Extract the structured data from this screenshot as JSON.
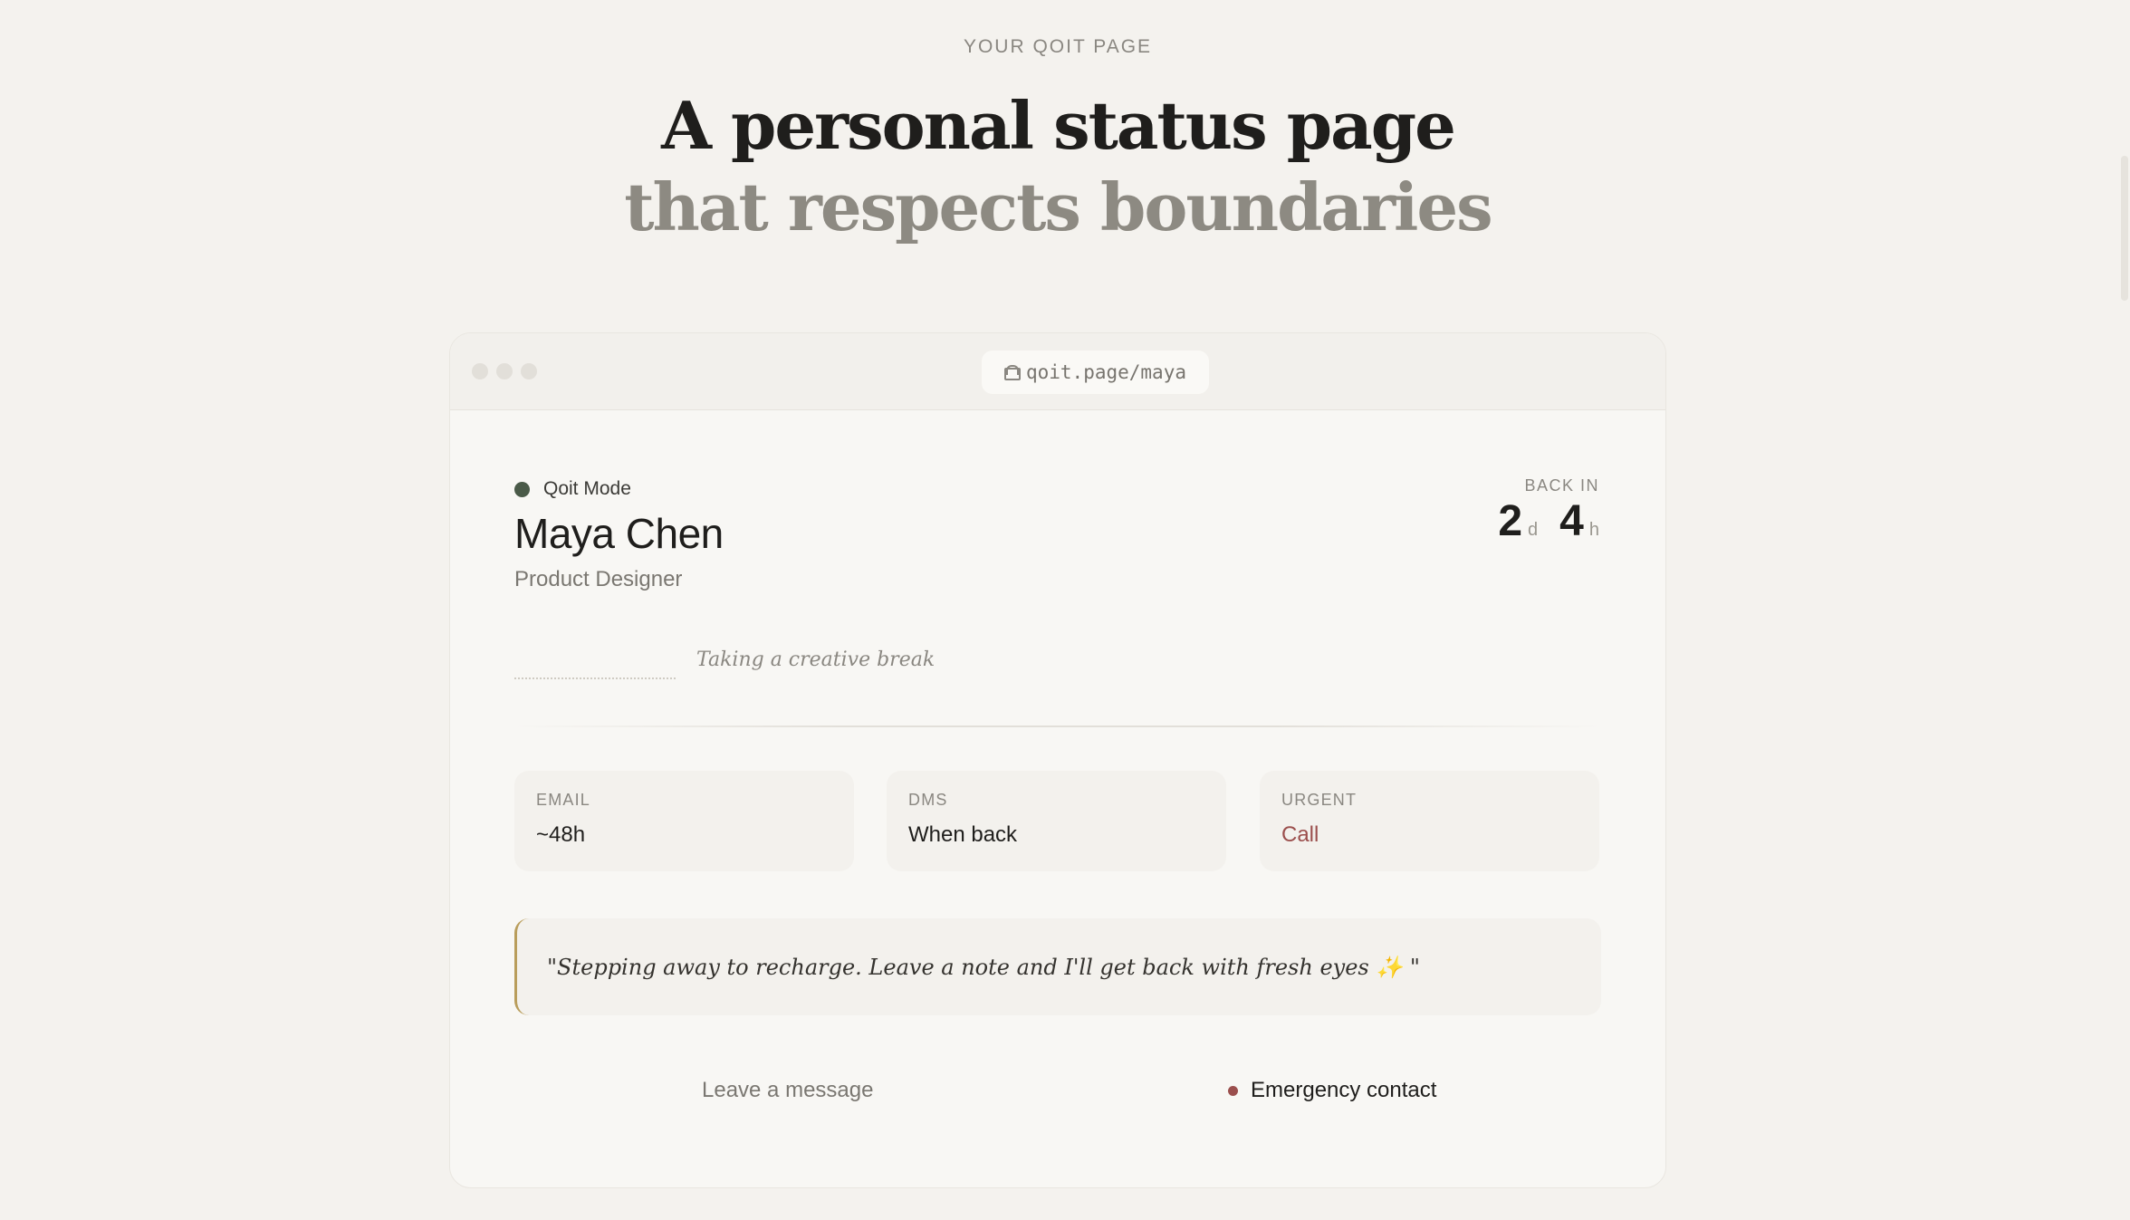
{
  "header": {
    "eyebrow": "YOUR QOIT PAGE",
    "title_line1": "A personal status page",
    "title_line2": "that respects boundaries"
  },
  "browser": {
    "url": "qoit.page/maya",
    "window_dots": [
      "close",
      "minimize",
      "maximize"
    ]
  },
  "profile": {
    "mode": "Qoit Mode",
    "name": "Maya Chen",
    "role": "Product Designer",
    "status": "Taking a creative break"
  },
  "back_in": {
    "label": "BACK IN",
    "days": "2",
    "days_unit": "d",
    "hours": "4",
    "hours_unit": "h"
  },
  "channels": [
    {
      "label": "EMAIL",
      "value": "~48h"
    },
    {
      "label": "DMS",
      "value": "When back"
    },
    {
      "label": "URGENT",
      "value": "Call"
    }
  ],
  "quote": "\"Stepping away to recharge. Leave a note and I'll get back with fresh eyes ✨ \"",
  "actions": {
    "leave_message": "Leave a message",
    "emergency": "Emergency contact"
  },
  "colors": {
    "background": "#f4f2ee",
    "accent_green": "#4a5a48",
    "urgent": "#9b4f4d",
    "quote_border": "#b99d5b"
  }
}
